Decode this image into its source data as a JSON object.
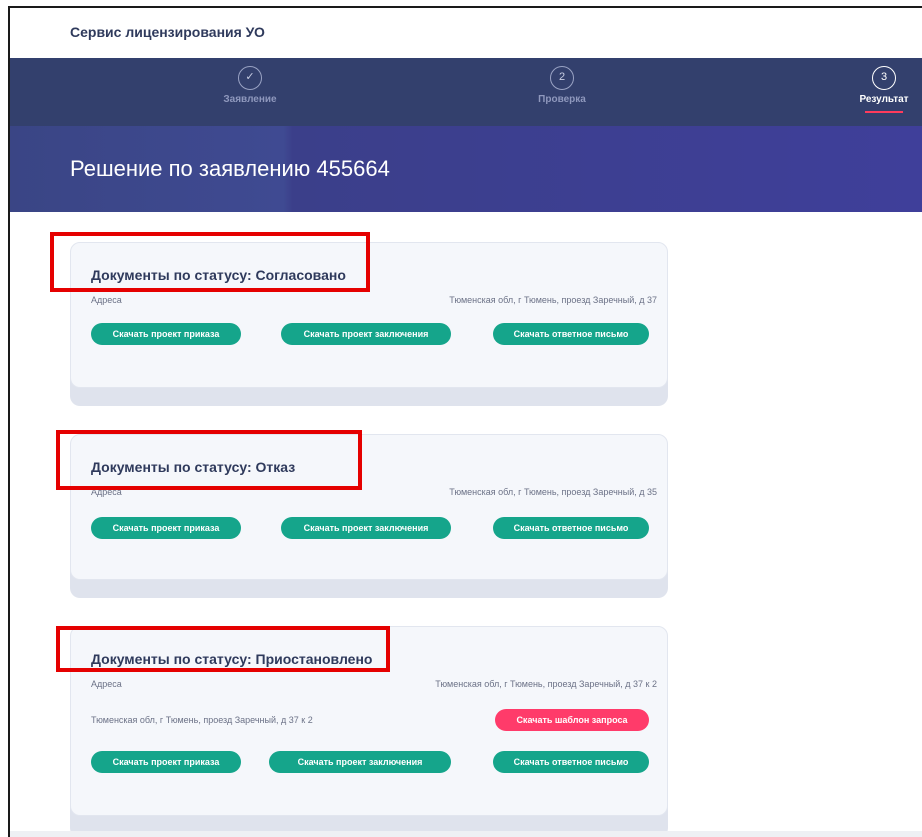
{
  "app": {
    "title": "Сервис лицензирования УО"
  },
  "stepper": {
    "steps": [
      {
        "icon": "check-icon",
        "symbol": "✓",
        "label": "Заявление"
      },
      {
        "icon": "number-2-icon",
        "symbol": "2",
        "label": "Проверка"
      },
      {
        "icon": "number-3-icon",
        "symbol": "3",
        "label": "Результат"
      }
    ],
    "active_index": 2
  },
  "hero": {
    "title": "Решение по заявлению 455664"
  },
  "cards": [
    {
      "title": "Документы по статусу: Согласовано",
      "address_label": "Адреса",
      "address_value": "Тюменская обл, г Тюмень, проезд Заречный, д 37",
      "buttons": [
        "Скачать проект приказа",
        "Скачать проект заключения",
        "Скачать ответное письмо"
      ]
    },
    {
      "title": "Документы по статусу: Отказ",
      "address_label": "Адреса",
      "address_value": "Тюменская обл, г Тюмень, проезд Заречный, д 35",
      "buttons": [
        "Скачать проект приказа",
        "Скачать проект заключения",
        "Скачать ответное письмо"
      ]
    },
    {
      "title": "Документы по статусу: Приостановлено",
      "address_label": "Адреса",
      "address_value": "Тюменская обл, г Тюмень, проезд Заречный, д 37 к 2",
      "request_row_text": "Тюменская обл, г Тюмень, проезд Заречный, д 37 к 2",
      "request_button": "Скачать шаблон запроса",
      "buttons": [
        "Скачать проект приказа",
        "Скачать проект заключения",
        "Скачать ответное письмо"
      ]
    }
  ],
  "colors": {
    "stepper_bg": "#33406d",
    "hero_bg": "#3f4a92",
    "accent_green": "#15a58b",
    "accent_pink": "#ff3b6a",
    "highlight_red": "#e50000"
  }
}
